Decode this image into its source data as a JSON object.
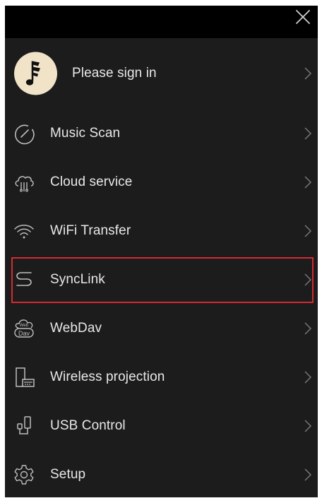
{
  "menu": {
    "close_icon": "close-icon",
    "signin": {
      "label": "Please sign in",
      "icon": "music-note-avatar-icon"
    },
    "items": [
      {
        "label": "Music Scan",
        "icon": "scan-gauge-icon"
      },
      {
        "label": "Cloud service",
        "icon": "cloud-icon"
      },
      {
        "label": "WiFi Transfer",
        "icon": "wifi-icon"
      },
      {
        "label": "SyncLink",
        "icon": "synclink-icon"
      },
      {
        "label": "WebDav",
        "icon": "webdav-icon"
      },
      {
        "label": "Wireless projection",
        "icon": "projection-icon"
      },
      {
        "label": "USB Control",
        "icon": "usb-icon"
      },
      {
        "label": "Setup",
        "icon": "settings-gear-icon"
      }
    ],
    "highlighted_item": "SyncLink"
  },
  "colors": {
    "background": "#1c1c1c",
    "top_bar": "#000000",
    "text": "#e8e8e8",
    "icon": "#bdbdbd",
    "avatar": "#f1e3c8",
    "highlight_border": "#d42a33"
  }
}
